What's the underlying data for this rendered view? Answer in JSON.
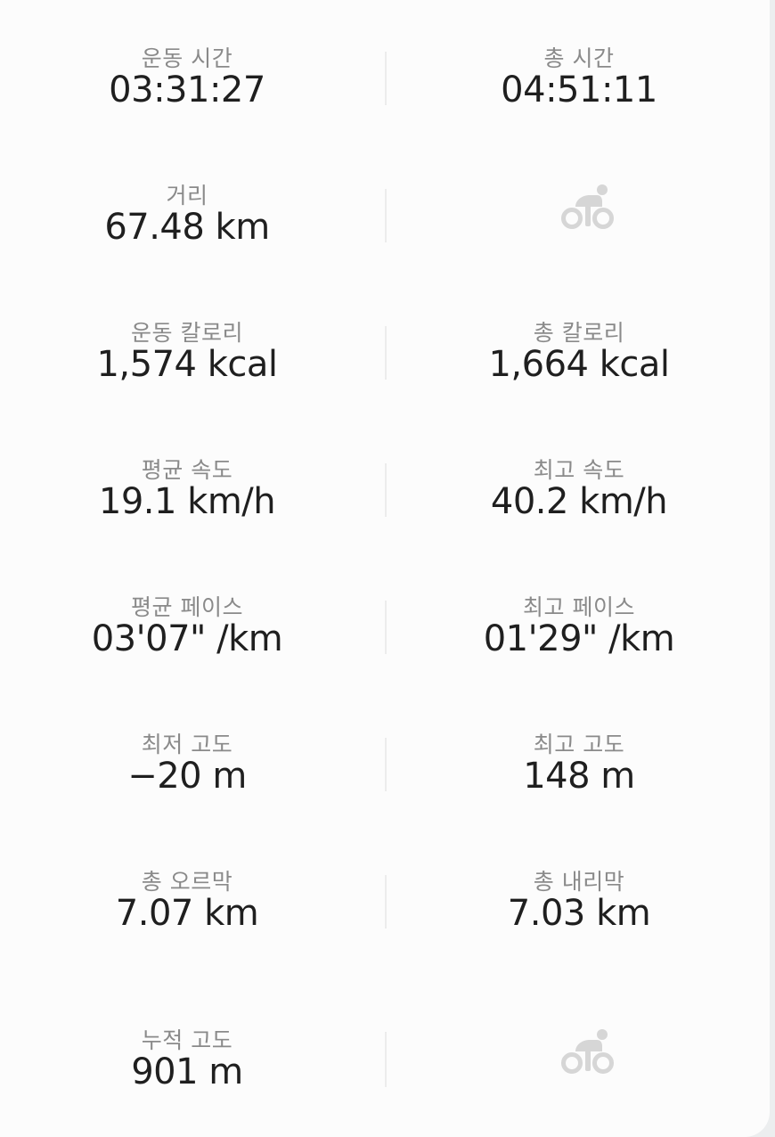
{
  "metrics": {
    "exercise_time": {
      "label": "운동 시간",
      "value": "03:31:27"
    },
    "total_time": {
      "label": "총 시간",
      "value": "04:51:11"
    },
    "distance": {
      "label": "거리",
      "value": "67.48 km"
    },
    "exercise_calories": {
      "label": "운동 칼로리",
      "value": "1,574 kcal"
    },
    "total_calories": {
      "label": "총 칼로리",
      "value": "1,664 kcal"
    },
    "avg_speed": {
      "label": "평균 속도",
      "value": "19.1 km/h"
    },
    "max_speed": {
      "label": "최고 속도",
      "value": "40.2 km/h"
    },
    "avg_pace": {
      "label": "평균 페이스",
      "value": "03'07\" /km"
    },
    "best_pace": {
      "label": "최고 페이스",
      "value": "01'29\" /km"
    },
    "min_altitude": {
      "label": "최저 고도",
      "value": "−20 m"
    },
    "max_altitude": {
      "label": "최고 고도",
      "value": "148 m"
    },
    "total_uphill": {
      "label": "총 오르막",
      "value": "7.07 km"
    },
    "total_downhill": {
      "label": "총 내리막",
      "value": "7.03 km"
    },
    "cumulative_elevation": {
      "label": "누적 고도",
      "value": "901 m"
    }
  },
  "icons": {
    "placeholder_icon": "cycling-icon",
    "icon_color": "#d6d6d6"
  },
  "colors": {
    "label": "#8a8a8a",
    "value": "#1f1f1f",
    "background": "#fcfcfc"
  }
}
